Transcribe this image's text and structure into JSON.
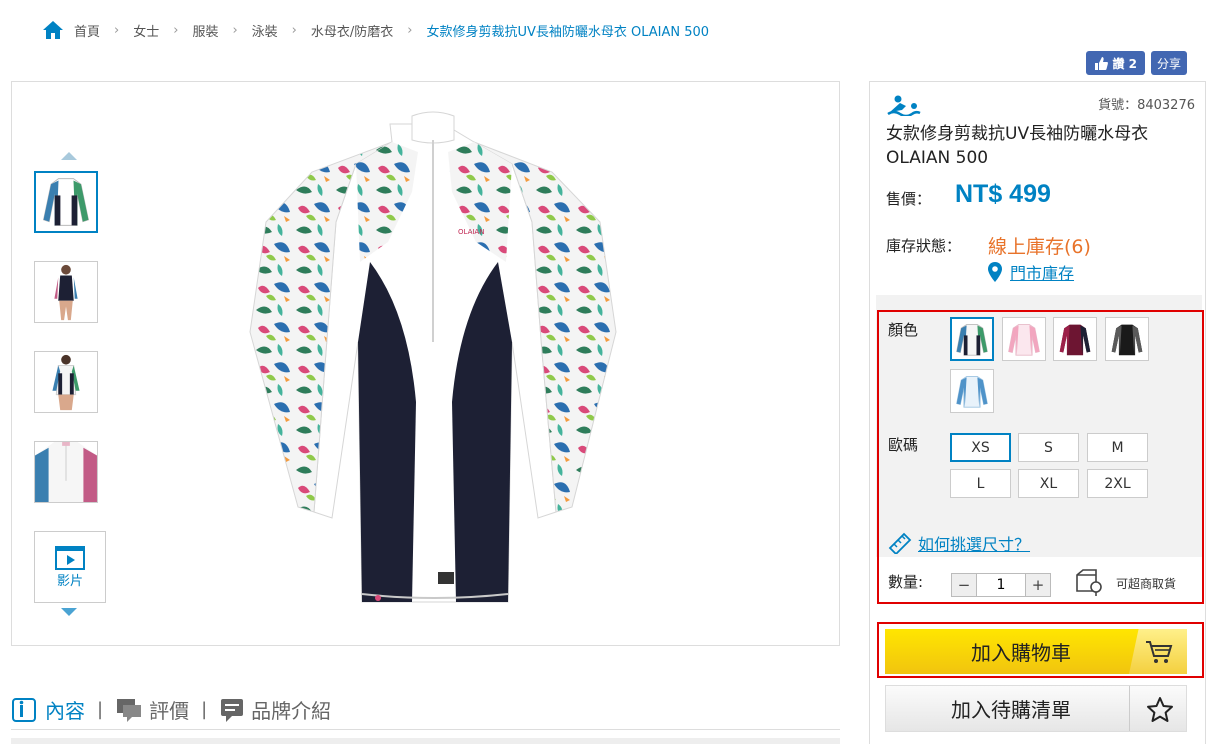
{
  "breadcrumb": {
    "items": [
      "首頁",
      "女士",
      "服裝",
      "泳裝",
      "水母衣/防磨衣"
    ],
    "current": "女款修身剪裁抗UV長袖防曬水母衣 OLAIAN 500"
  },
  "facebook": {
    "like_label": "讚 2",
    "share_label": "分享"
  },
  "gallery": {
    "video_label": "影片"
  },
  "tabs": [
    {
      "label": "內容",
      "active": true
    },
    {
      "label": "評價",
      "active": false
    },
    {
      "label": "品牌介紹",
      "active": false
    }
  ],
  "product": {
    "sku_label": "貨號：8403276",
    "title": "女款修身剪裁抗UV長袖防曬水母衣 OLAIAN 500",
    "price_label": "售價：",
    "price": "NT$ 499",
    "stock_label": "庫存狀態：",
    "stock_online": "線上庫存(6)",
    "store_stock": "門市庫存"
  },
  "options": {
    "color_label": "顏色",
    "colors": [
      "white-floral",
      "pink-floral",
      "burgundy",
      "black-floral",
      "blue-floral"
    ],
    "size_label": "歐碼",
    "sizes": [
      "XS",
      "S",
      "M",
      "L",
      "XL",
      "2XL"
    ],
    "selected_size": "XS",
    "size_guide": "如何挑選尺寸？",
    "qty_label": "數量:",
    "qty_value": "1",
    "pickup_label": "可超商取貨"
  },
  "actions": {
    "add_to_cart": "加入購物車",
    "add_to_wishlist": "加入待購清單"
  },
  "colors": {
    "accent": "#0082c3",
    "stock": "#e8732a",
    "cart_yellow": "#ffe600",
    "highlight_red": "#e00000"
  }
}
